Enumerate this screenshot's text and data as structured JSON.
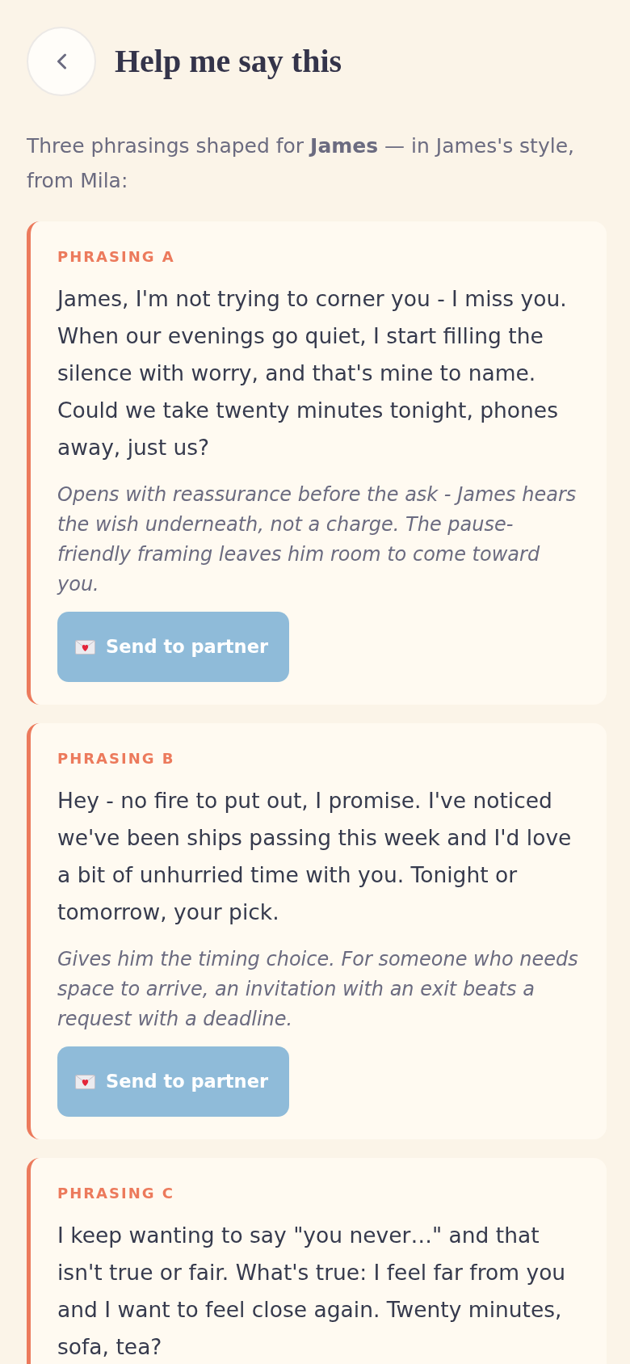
{
  "header": {
    "title": "Help me say this"
  },
  "intro": "Three phrasings shaped for **James** — in James's style, from Mila:",
  "phrasings": [
    {
      "label": "PHRASING A",
      "message": "James, I'm not trying to corner you - I miss you. When our evenings go quiet, I start filling the silence with worry, and that's mine to name. Could we take twenty minutes tonight, phones away, just us?",
      "note": "Opens with reassurance before the ask - James hears the wish underneath, not a charge. The pause-friendly framing leaves him room to come toward you.",
      "button": "Send to partner"
    },
    {
      "label": "PHRASING B",
      "message": "Hey - no fire to put out, I promise. I've noticed we've been ships passing this week and I'd love a bit of unhurried time with you. Tonight or tomorrow, your pick.",
      "note": "Gives him the timing choice. For someone who needs space to arrive, an invitation with an exit beats a request with a deadline.",
      "button": "Send to partner"
    },
    {
      "label": "PHRASING C",
      "message": "I keep wanting to say \"you never…\" and that isn't true or fair. What's true: I feel far from you and I want to feel close again. Twenty minutes, sofa, tea?"
    }
  ]
}
